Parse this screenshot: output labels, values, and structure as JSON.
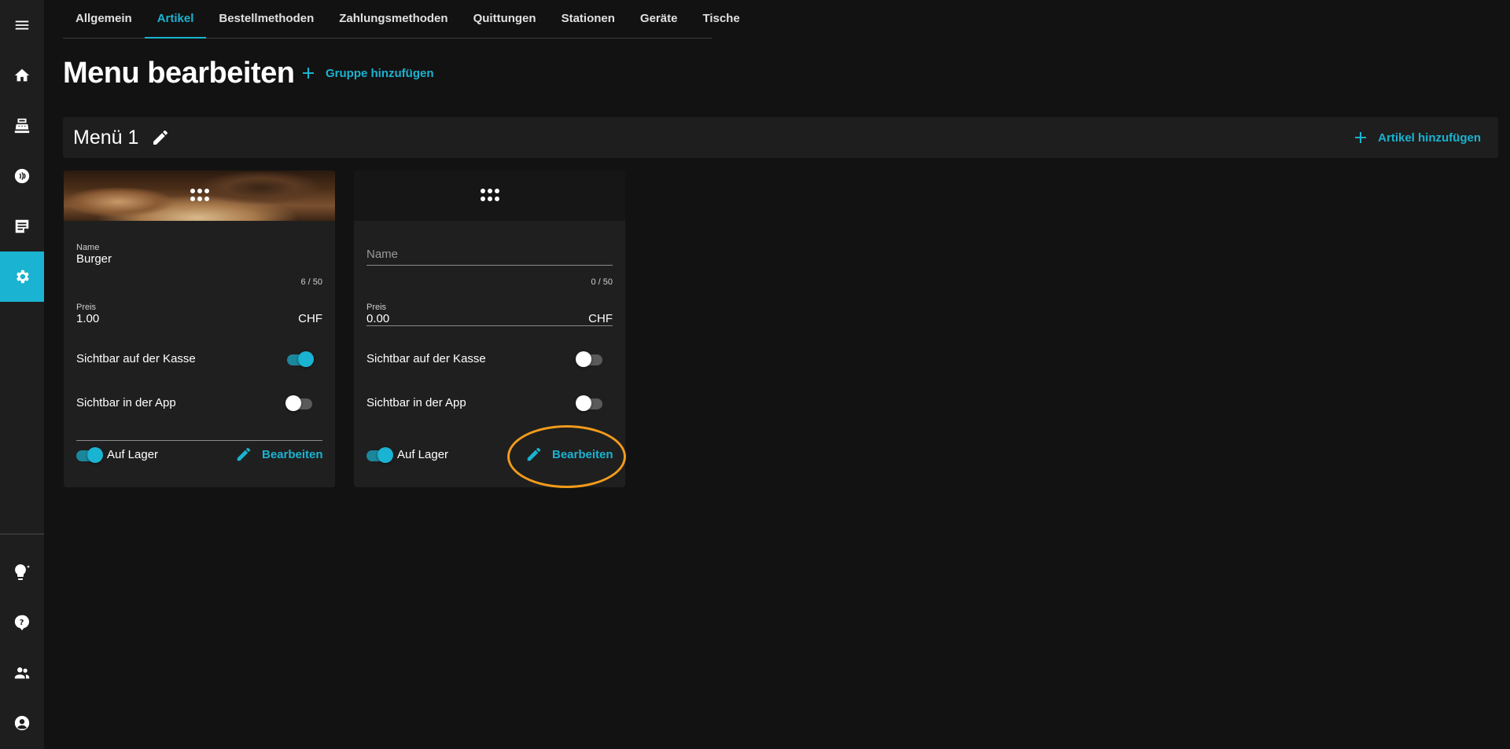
{
  "sidebar": {
    "items": [
      {
        "icon": "menu-icon"
      },
      {
        "icon": "home-icon"
      },
      {
        "icon": "cash-register-icon"
      },
      {
        "icon": "nfc-icon"
      },
      {
        "icon": "orders-icon"
      },
      {
        "icon": "settings-icon",
        "active": true
      },
      {
        "icon": "lightbulb-icon"
      },
      {
        "icon": "help-icon"
      },
      {
        "icon": "users-icon"
      },
      {
        "icon": "account-icon"
      }
    ]
  },
  "tabs": [
    {
      "label": "Allgemein"
    },
    {
      "label": "Artikel",
      "active": true
    },
    {
      "label": "Bestellmethoden"
    },
    {
      "label": "Zahlungsmethoden"
    },
    {
      "label": "Quittungen"
    },
    {
      "label": "Stationen"
    },
    {
      "label": "Geräte"
    },
    {
      "label": "Tische"
    }
  ],
  "page": {
    "title": "Menu bearbeiten",
    "add_group_label": "Gruppe hinzufügen"
  },
  "group": {
    "title": "Menü 1",
    "add_article_label": "Artikel hinzufügen"
  },
  "cards": [
    {
      "has_image": true,
      "name_label": "Name",
      "name_value": "Burger",
      "name_counter": "6 / 50",
      "price_label": "Preis",
      "price_value": "1.00",
      "currency": "CHF",
      "visible_pos_label": "Sichtbar auf der Kasse",
      "visible_pos": true,
      "visible_app_label": "Sichtbar in der App",
      "visible_app": false,
      "in_stock_label": "Auf Lager",
      "in_stock": true,
      "edit_label": "Bearbeiten"
    },
    {
      "has_image": false,
      "name_placeholder": "Name",
      "name_value": "",
      "name_counter": "0 / 50",
      "price_label": "Preis",
      "price_value": "0.00",
      "currency": "CHF",
      "visible_pos_label": "Sichtbar auf der Kasse",
      "visible_pos": false,
      "visible_app_label": "Sichtbar in der App",
      "visible_app": false,
      "in_stock_label": "Auf Lager",
      "in_stock": true,
      "edit_label": "Bearbeiten"
    }
  ],
  "colors": {
    "accent": "#1ab3d1",
    "highlight": "#f29b1b",
    "background": "#121212",
    "surface": "#1f1f1f"
  }
}
